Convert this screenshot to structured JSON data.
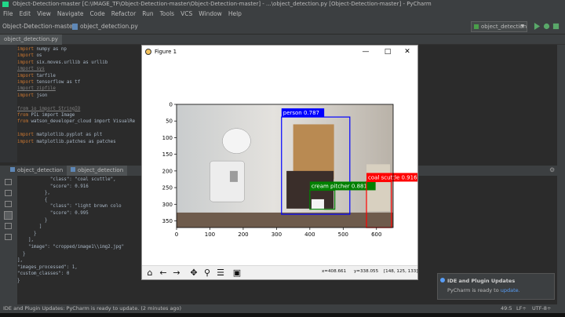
{
  "window": {
    "title": "Object-Detection-master [C:\\IMAGE_TF\\Object-Detection-master\\Object-Detection-master] - ...\\object_detection.py [Object-Detection-master] - PyCharm"
  },
  "menu": [
    "File",
    "Edit",
    "View",
    "Navigate",
    "Code",
    "Refactor",
    "Run",
    "Tools",
    "VCS",
    "Window",
    "Help"
  ],
  "breadcrumb": {
    "project": "Object-Detection-master",
    "file": "object_detection.py"
  },
  "run_config": {
    "label": "object_detection"
  },
  "editor": {
    "tabs": [
      "object_detection.py"
    ],
    "code_lines": [
      {
        "kw": "import",
        "rest": " numpy as np"
      },
      {
        "kw": "import",
        "rest": " os"
      },
      {
        "kw": "import",
        "rest": " six.moves.urllib as urllib"
      },
      {
        "kw": "import",
        "rest": " sys",
        "dim": true
      },
      {
        "kw": "import",
        "rest": " tarfile"
      },
      {
        "kw": "import",
        "rest": " tensorflow as tf"
      },
      {
        "kw": "import",
        "rest": " zipfile",
        "dim": true
      },
      {
        "kw": "import",
        "rest": " json"
      },
      {
        "kw": "",
        "rest": ""
      },
      {
        "kw": "from",
        "rest": " io import StringIO",
        "dim": true
      },
      {
        "kw": "from",
        "rest": " PIL import Image"
      },
      {
        "kw": "from",
        "rest": " watson_developer_cloud import VisualRe"
      },
      {
        "kw": "",
        "rest": ""
      },
      {
        "kw": "import",
        "rest": " matplotlib.pyplot as plt"
      },
      {
        "kw": "import",
        "rest": " matplotlib.patches as patches"
      }
    ]
  },
  "run_panel": {
    "tabs": [
      "object_detection",
      "object_detection"
    ],
    "output_lines": [
      "            \"class\": \"coal scuttle\",",
      "            \"score\": 0.916",
      "          },",
      "          {",
      "            \"class\": \"light brown colo",
      "            \"score\": 0.995",
      "          }",
      "        ]",
      "      }",
      "    ],",
      "    \"image\": \"cropped/image1\\\\img2.jpg\"",
      "  }",
      "],",
      "\"images_processed\": 1,",
      "\"custom_classes\": 0",
      "}"
    ]
  },
  "figure": {
    "title": "Figure 1",
    "window_buttons": [
      "—",
      "□",
      "✕"
    ],
    "status": {
      "x": "x=408.661",
      "y": "y=338.055",
      "pixel": "[148, 125, 133]"
    },
    "tools": [
      "home-icon",
      "back-icon",
      "forward-icon",
      "pan-icon",
      "zoom-icon",
      "configure-icon",
      "save-icon"
    ]
  },
  "chart_data": {
    "type": "image",
    "x_ticks": [
      0,
      100,
      200,
      300,
      400,
      500,
      600
    ],
    "y_ticks": [
      0,
      50,
      100,
      150,
      200,
      250,
      300,
      350
    ],
    "xlim": [
      0,
      650
    ],
    "ylim": [
      370,
      0
    ],
    "boxes": [
      {
        "label": "person 0.787",
        "color": "#0000ff",
        "x0": 315,
        "y0": 38,
        "x1": 520,
        "y1": 330
      },
      {
        "label": "cream pitcher 0.881",
        "color": "#008000",
        "x0": 400,
        "y0": 258,
        "x1": 475,
        "y1": 315
      },
      {
        "label": "coal scuttle 0.916",
        "color": "#ff0000",
        "x0": 570,
        "y0": 232,
        "x1": 645,
        "y1": 370
      }
    ]
  },
  "notification": {
    "title": "IDE and Plugin Updates",
    "body": "PyCharm is ready to ",
    "link": "update."
  },
  "statusbar": {
    "message": "IDE and Plugin Updates: PyCharm is ready to update. (2 minutes ago)",
    "position": "49:5",
    "line_sep": "LF÷",
    "encoding": "UTF-8÷"
  },
  "colors": {
    "ide_bg": "#2b2b2b",
    "panel": "#3c3f41",
    "keyword": "#cc7832",
    "text": "#a9b7c6"
  }
}
